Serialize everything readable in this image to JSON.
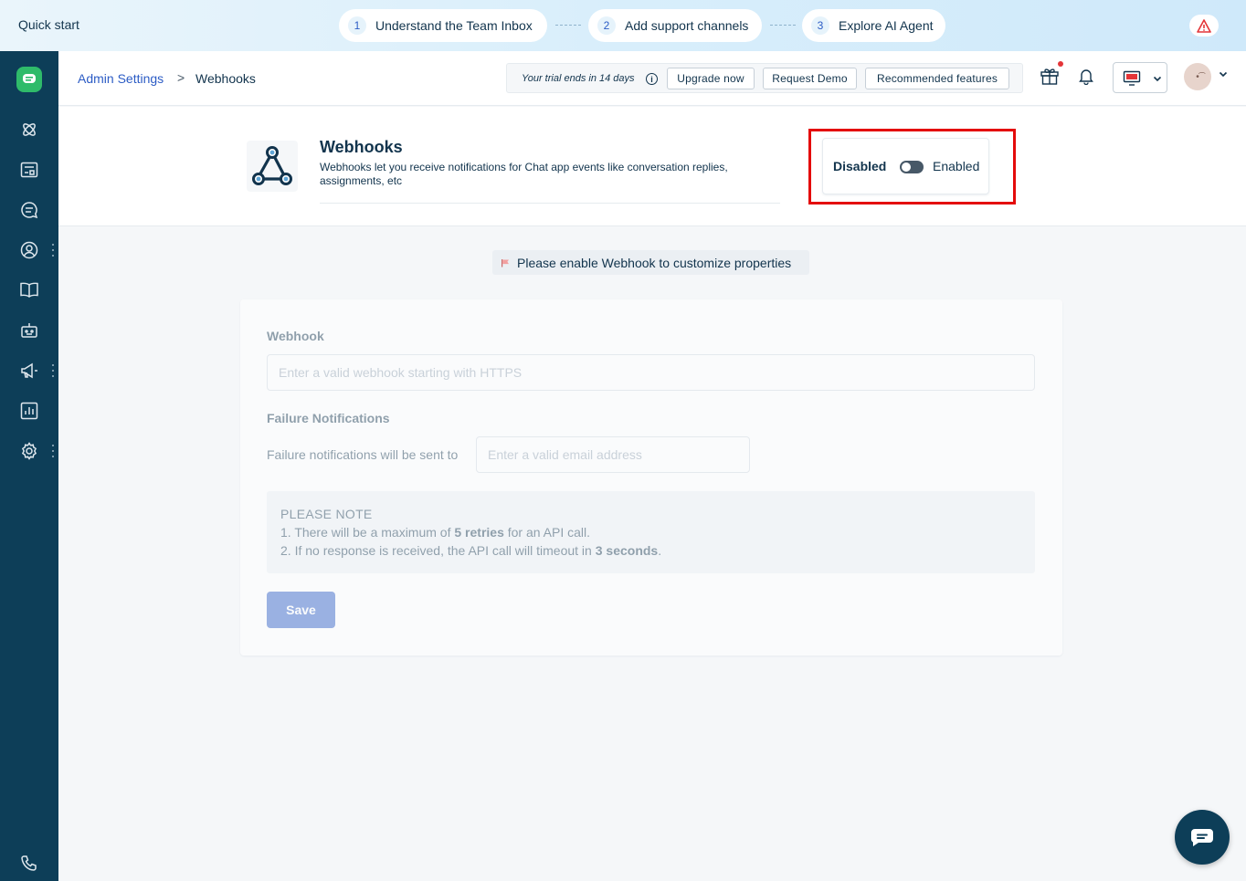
{
  "quick_start": {
    "title": "Quick start",
    "steps": [
      {
        "num": "1",
        "label": "Understand the Team Inbox"
      },
      {
        "num": "2",
        "label": "Add support channels"
      },
      {
        "num": "3",
        "label": "Explore AI Agent"
      }
    ]
  },
  "breadcrumb": {
    "parent": "Admin Settings",
    "separator": ">",
    "current": "Webhooks"
  },
  "header": {
    "trial_text": "Your trial ends in 14 days",
    "upgrade_label": "Upgrade now",
    "demo_label": "Request Demo",
    "recommended_label": "Recommended features",
    "avatar_initials": "•͡"
  },
  "feature": {
    "title": "Webhooks",
    "description": "Webhooks let you receive notifications for Chat app events like conversation replies, assignments, etc",
    "toggle_off_label": "Disabled",
    "toggle_on_label": "Enabled",
    "enabled": false
  },
  "warning": {
    "text": "Please enable Webhook to customize properties"
  },
  "form": {
    "webhook_label": "Webhook",
    "webhook_placeholder": "Enter a valid webhook starting with HTTPS",
    "failure_label": "Failure Notifications",
    "sent_to_label": "Failure notifications will be sent to",
    "email_placeholder": "Enter a valid email address",
    "note_title": "PLEASE NOTE",
    "note_line1_pre": "1. There will be a maximum of ",
    "note_line1_bold": "5 retries",
    "note_line1_post": " for an API call.",
    "note_line2_pre": "2. If no response is received, the API call will timeout in ",
    "note_line2_bold": "3 seconds",
    "note_line2_post": ".",
    "save_label": "Save"
  },
  "colors": {
    "sidebar": "#0d3e58",
    "accent": "#2c5cc5",
    "highlight": "#e40b0b",
    "brand_green": "#2fbb6a"
  }
}
